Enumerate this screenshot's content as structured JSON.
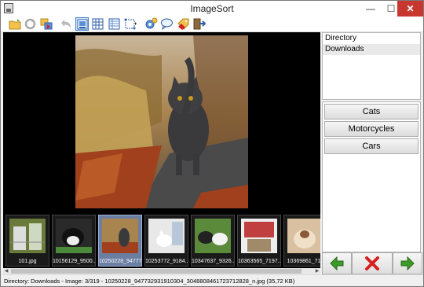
{
  "window": {
    "title": "ImageSort"
  },
  "titlebar": {
    "minimize_glyph": "—",
    "maximize_glyph": "☐",
    "close_glyph": "✕"
  },
  "toolbar": {
    "buttons": [
      {
        "name": "open-folder-icon"
      },
      {
        "name": "refresh-icon"
      },
      {
        "name": "move-icon"
      },
      {
        "name": "undo-icon"
      },
      {
        "name": "view-single-icon",
        "active": true
      },
      {
        "name": "view-grid-icon"
      },
      {
        "name": "view-list-icon"
      },
      {
        "name": "crop-icon"
      },
      {
        "name": "settings-icon"
      },
      {
        "name": "comment-icon"
      },
      {
        "name": "tags-icon"
      },
      {
        "name": "exit-icon"
      }
    ]
  },
  "thumbnails": [
    {
      "caption": "101.jpg"
    },
    {
      "caption": "10156129_9500..."
    },
    {
      "caption": "10250228_94777...",
      "selected": true
    },
    {
      "caption": "10253772_9184..."
    },
    {
      "caption": "10347637_9326..."
    },
    {
      "caption": "10363565_7197..."
    },
    {
      "caption": "10369861_718"
    }
  ],
  "directory": {
    "items": [
      {
        "label": "Directory"
      },
      {
        "label": "Downloads"
      }
    ]
  },
  "categories": [
    {
      "label": "Cats"
    },
    {
      "label": "Motorcycles"
    },
    {
      "label": "Cars"
    }
  ],
  "nav": {
    "prev_icon": "arrow-left-icon",
    "delete_icon": "delete-icon",
    "next_icon": "arrow-right-icon"
  },
  "status": {
    "text": "Directory: Downloads - Image: 3/319 - 10250228_947732931910304_3048808461723712828_n.jpg (35,72 KB)"
  },
  "colors": {
    "close": "#c7372f",
    "accent": "#3d7fcc",
    "nav_arrow": "#3a9a2a",
    "delete": "#d42020"
  }
}
